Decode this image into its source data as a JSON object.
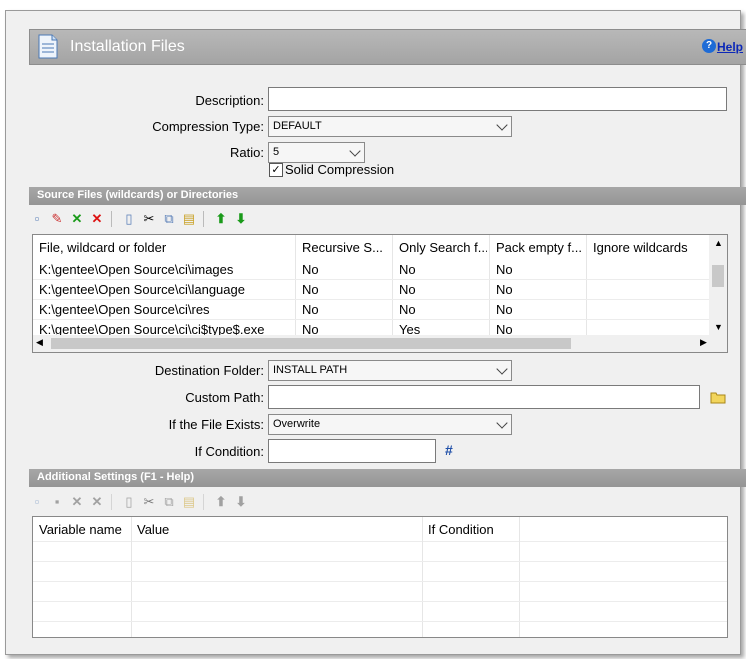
{
  "header": {
    "title": "Installation Files",
    "help_label": "Help",
    "help_icon": "question-icon"
  },
  "form": {
    "description_label": "Description:",
    "description_value": "",
    "compression_label": "Compression Type:",
    "compression_value": "DEFAULT",
    "ratio_label": "Ratio:",
    "ratio_value": "5",
    "solid_label": "Solid Compression",
    "solid_checked": true
  },
  "source_section": {
    "title": "Source Files (wildcards) or Directories"
  },
  "source_toolbar": [
    "new-icon",
    "edit-icon",
    "check-icon",
    "delete-icon",
    "copy-icon",
    "cut-icon",
    "duplicate-icon",
    "paste-icon",
    "arrow-up-icon",
    "arrow-down-icon"
  ],
  "source_table": {
    "columns": [
      "File, wildcard or folder",
      "Recursive S...",
      "Only Search f...",
      "Pack empty f...",
      "Ignore wildcards"
    ],
    "rows": [
      [
        "K:\\gentee\\Open Source\\ci\\images",
        "No",
        "No",
        "No",
        ""
      ],
      [
        "K:\\gentee\\Open Source\\ci\\language",
        "No",
        "No",
        "No",
        ""
      ],
      [
        "K:\\gentee\\Open Source\\ci\\res",
        "No",
        "No",
        "No",
        ""
      ],
      [
        "K:\\gentee\\Open Source\\ci\\ci$type$.exe",
        "No",
        "Yes",
        "No",
        ""
      ]
    ]
  },
  "dest": {
    "dest_label": "Destination Folder:",
    "dest_value": "INSTALL PATH",
    "custom_label": "Custom Path:",
    "custom_value": "",
    "exists_label": "If the File Exists:",
    "exists_value": "Overwrite",
    "condition_label": "If Condition:",
    "condition_value": "",
    "hash": "#"
  },
  "additional_section": {
    "title": "Additional Settings (F1 - Help)"
  },
  "additional_table": {
    "columns": [
      "Variable name",
      "Value",
      "If Condition"
    ]
  }
}
